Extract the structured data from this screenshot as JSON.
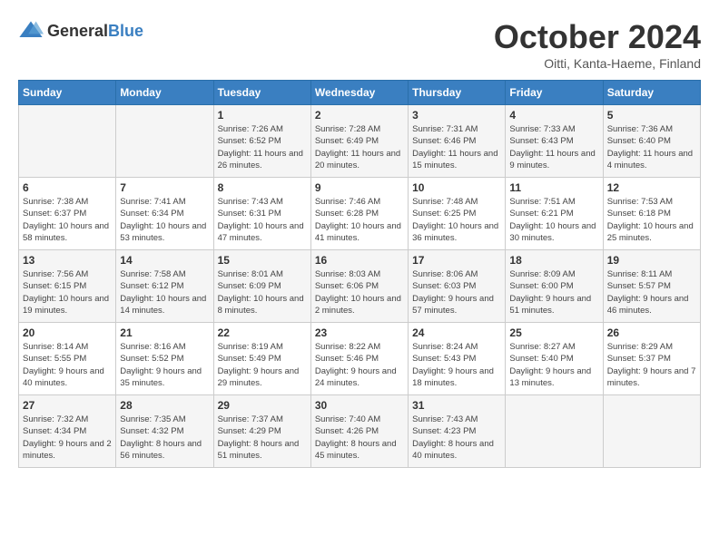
{
  "logo": {
    "general": "General",
    "blue": "Blue"
  },
  "title": "October 2024",
  "location": "Oitti, Kanta-Haeme, Finland",
  "days_of_week": [
    "Sunday",
    "Monday",
    "Tuesday",
    "Wednesday",
    "Thursday",
    "Friday",
    "Saturday"
  ],
  "weeks": [
    [
      {
        "day": "",
        "info": ""
      },
      {
        "day": "",
        "info": ""
      },
      {
        "day": "1",
        "info": "Sunrise: 7:26 AM\nSunset: 6:52 PM\nDaylight: 11 hours\nand 26 minutes."
      },
      {
        "day": "2",
        "info": "Sunrise: 7:28 AM\nSunset: 6:49 PM\nDaylight: 11 hours\nand 20 minutes."
      },
      {
        "day": "3",
        "info": "Sunrise: 7:31 AM\nSunset: 6:46 PM\nDaylight: 11 hours\nand 15 minutes."
      },
      {
        "day": "4",
        "info": "Sunrise: 7:33 AM\nSunset: 6:43 PM\nDaylight: 11 hours\nand 9 minutes."
      },
      {
        "day": "5",
        "info": "Sunrise: 7:36 AM\nSunset: 6:40 PM\nDaylight: 11 hours\nand 4 minutes."
      }
    ],
    [
      {
        "day": "6",
        "info": "Sunrise: 7:38 AM\nSunset: 6:37 PM\nDaylight: 10 hours\nand 58 minutes."
      },
      {
        "day": "7",
        "info": "Sunrise: 7:41 AM\nSunset: 6:34 PM\nDaylight: 10 hours\nand 53 minutes."
      },
      {
        "day": "8",
        "info": "Sunrise: 7:43 AM\nSunset: 6:31 PM\nDaylight: 10 hours\nand 47 minutes."
      },
      {
        "day": "9",
        "info": "Sunrise: 7:46 AM\nSunset: 6:28 PM\nDaylight: 10 hours\nand 41 minutes."
      },
      {
        "day": "10",
        "info": "Sunrise: 7:48 AM\nSunset: 6:25 PM\nDaylight: 10 hours\nand 36 minutes."
      },
      {
        "day": "11",
        "info": "Sunrise: 7:51 AM\nSunset: 6:21 PM\nDaylight: 10 hours\nand 30 minutes."
      },
      {
        "day": "12",
        "info": "Sunrise: 7:53 AM\nSunset: 6:18 PM\nDaylight: 10 hours\nand 25 minutes."
      }
    ],
    [
      {
        "day": "13",
        "info": "Sunrise: 7:56 AM\nSunset: 6:15 PM\nDaylight: 10 hours\nand 19 minutes."
      },
      {
        "day": "14",
        "info": "Sunrise: 7:58 AM\nSunset: 6:12 PM\nDaylight: 10 hours\nand 14 minutes."
      },
      {
        "day": "15",
        "info": "Sunrise: 8:01 AM\nSunset: 6:09 PM\nDaylight: 10 hours\nand 8 minutes."
      },
      {
        "day": "16",
        "info": "Sunrise: 8:03 AM\nSunset: 6:06 PM\nDaylight: 10 hours\nand 2 minutes."
      },
      {
        "day": "17",
        "info": "Sunrise: 8:06 AM\nSunset: 6:03 PM\nDaylight: 9 hours\nand 57 minutes."
      },
      {
        "day": "18",
        "info": "Sunrise: 8:09 AM\nSunset: 6:00 PM\nDaylight: 9 hours\nand 51 minutes."
      },
      {
        "day": "19",
        "info": "Sunrise: 8:11 AM\nSunset: 5:57 PM\nDaylight: 9 hours\nand 46 minutes."
      }
    ],
    [
      {
        "day": "20",
        "info": "Sunrise: 8:14 AM\nSunset: 5:55 PM\nDaylight: 9 hours\nand 40 minutes."
      },
      {
        "day": "21",
        "info": "Sunrise: 8:16 AM\nSunset: 5:52 PM\nDaylight: 9 hours\nand 35 minutes."
      },
      {
        "day": "22",
        "info": "Sunrise: 8:19 AM\nSunset: 5:49 PM\nDaylight: 9 hours\nand 29 minutes."
      },
      {
        "day": "23",
        "info": "Sunrise: 8:22 AM\nSunset: 5:46 PM\nDaylight: 9 hours\nand 24 minutes."
      },
      {
        "day": "24",
        "info": "Sunrise: 8:24 AM\nSunset: 5:43 PM\nDaylight: 9 hours\nand 18 minutes."
      },
      {
        "day": "25",
        "info": "Sunrise: 8:27 AM\nSunset: 5:40 PM\nDaylight: 9 hours\nand 13 minutes."
      },
      {
        "day": "26",
        "info": "Sunrise: 8:29 AM\nSunset: 5:37 PM\nDaylight: 9 hours\nand 7 minutes."
      }
    ],
    [
      {
        "day": "27",
        "info": "Sunrise: 7:32 AM\nSunset: 4:34 PM\nDaylight: 9 hours\nand 2 minutes."
      },
      {
        "day": "28",
        "info": "Sunrise: 7:35 AM\nSunset: 4:32 PM\nDaylight: 8 hours\nand 56 minutes."
      },
      {
        "day": "29",
        "info": "Sunrise: 7:37 AM\nSunset: 4:29 PM\nDaylight: 8 hours\nand 51 minutes."
      },
      {
        "day": "30",
        "info": "Sunrise: 7:40 AM\nSunset: 4:26 PM\nDaylight: 8 hours\nand 45 minutes."
      },
      {
        "day": "31",
        "info": "Sunrise: 7:43 AM\nSunset: 4:23 PM\nDaylight: 8 hours\nand 40 minutes."
      },
      {
        "day": "",
        "info": ""
      },
      {
        "day": "",
        "info": ""
      }
    ]
  ]
}
